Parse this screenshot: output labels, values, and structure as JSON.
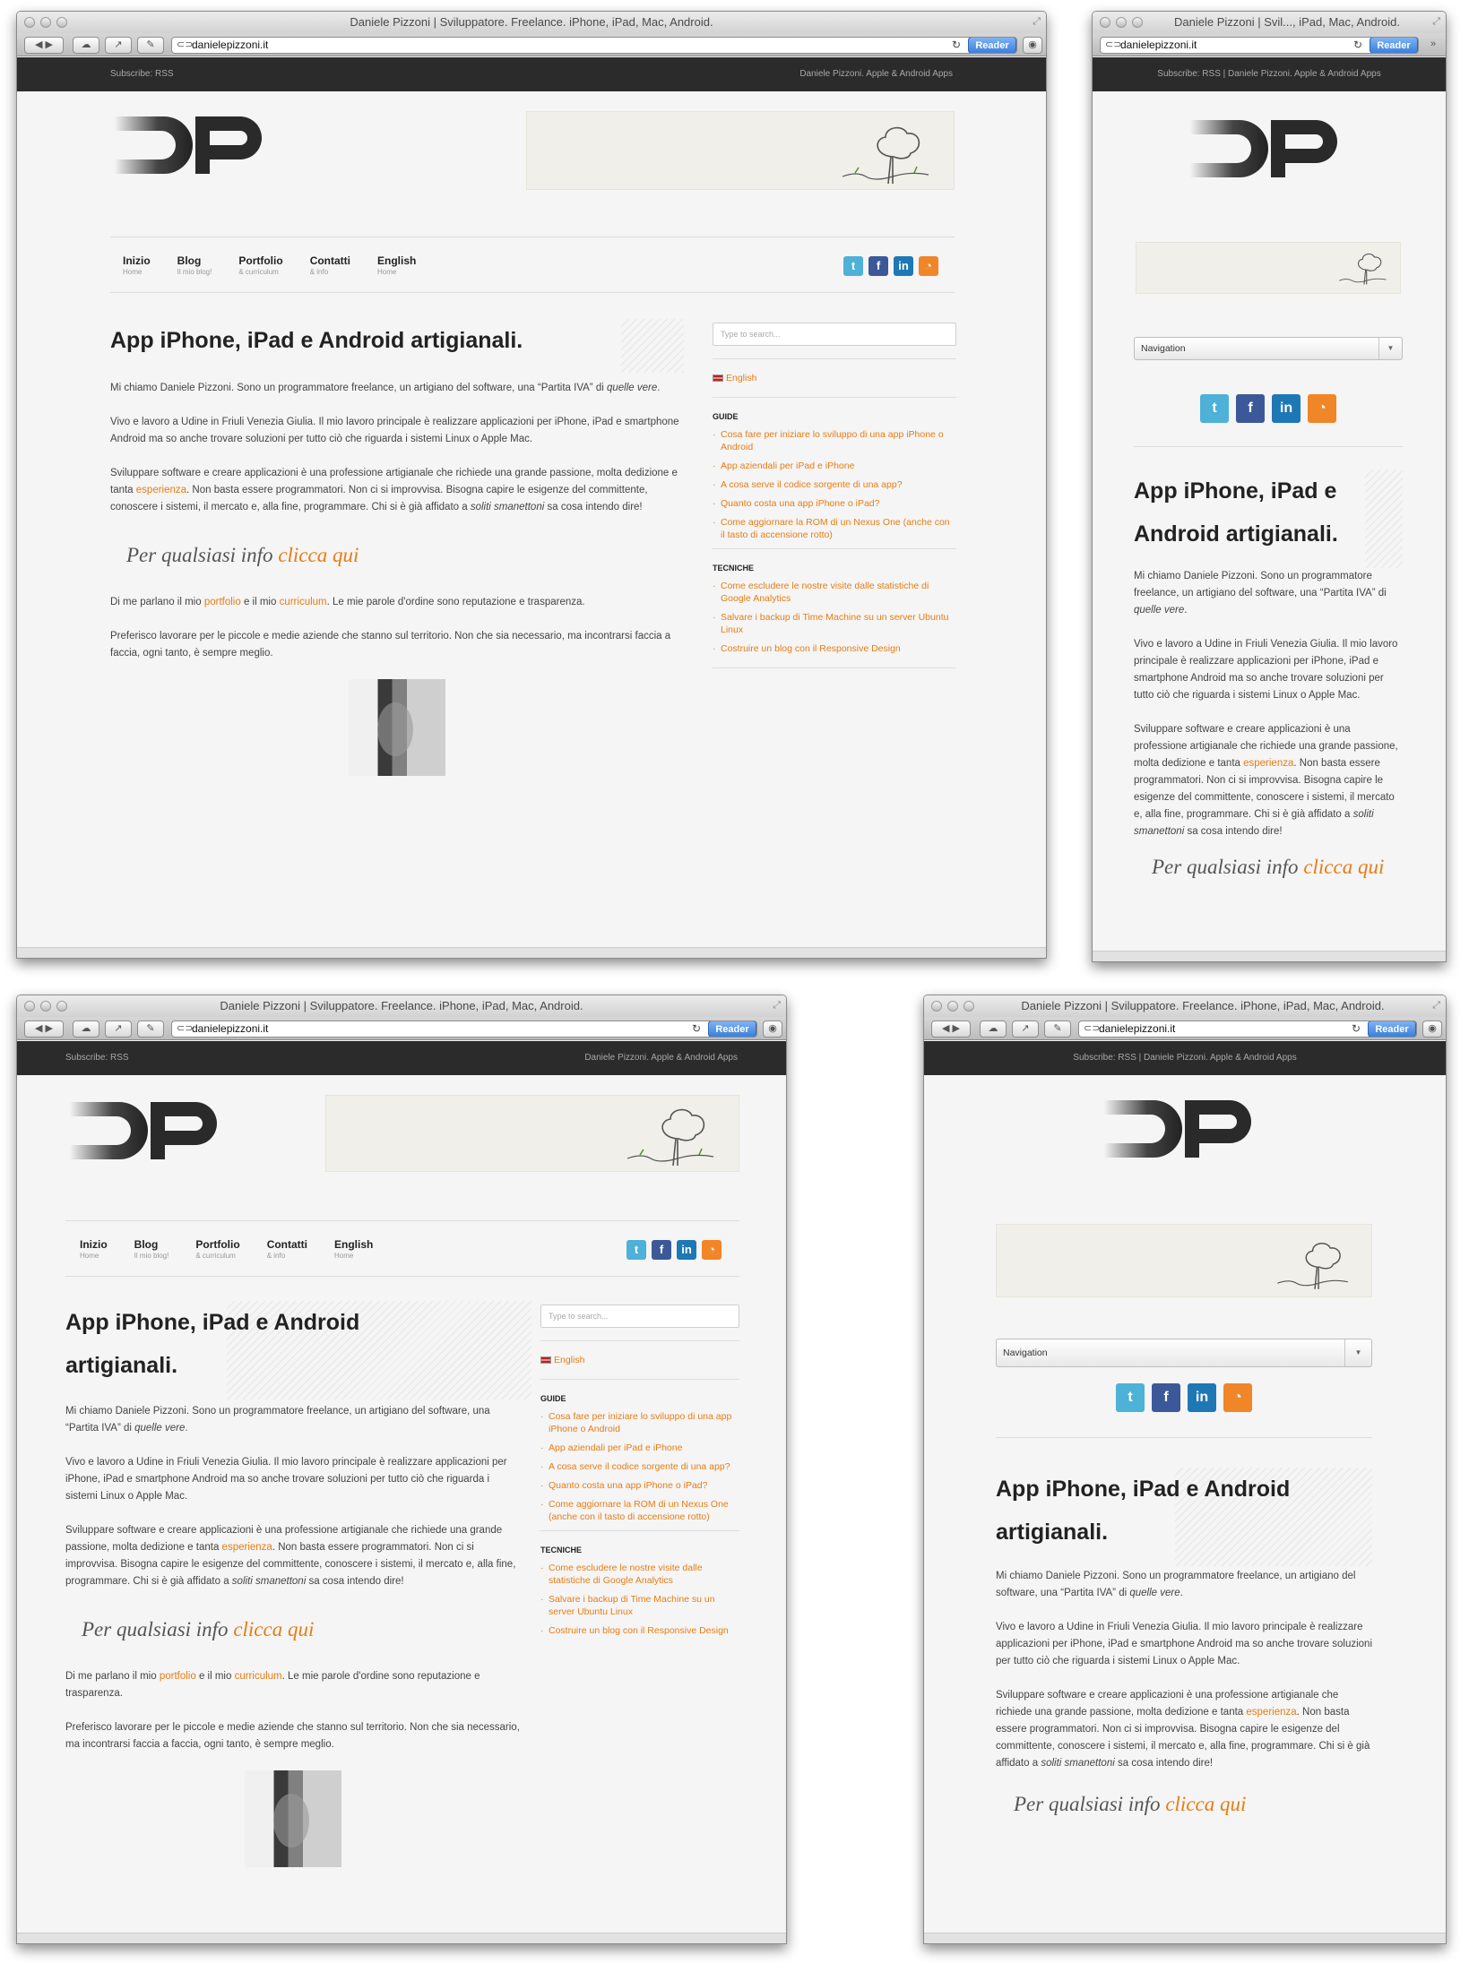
{
  "browser": {
    "title_full": "Daniele Pizzoni | Sviluppatore. Freelance. iPhone, iPad, Mac, Android.",
    "title_short": "Daniele Pizzoni | Svil..., iPad, Mac, Android.",
    "url": "danielepizzoni.it",
    "reader_label": "Reader"
  },
  "topbar": {
    "subscribe": "Subscribe: RSS",
    "tagline": "Daniele Pizzoni. Apple & Android Apps",
    "combined": "Subscribe: RSS | Daniele Pizzoni. Apple & Android Apps"
  },
  "nav": [
    {
      "label": "Inizio",
      "sub": "Home"
    },
    {
      "label": "Blog",
      "sub": "Il mio blog!"
    },
    {
      "label": "Portfolio",
      "sub": "& curriculum"
    },
    {
      "label": "Contatti",
      "sub": "& info"
    },
    {
      "label": "English",
      "sub": "Home"
    }
  ],
  "nav_select": "Navigation",
  "social": {
    "twitter": "t",
    "facebook": "f",
    "linkedin": "in",
    "rss": "rss-icon"
  },
  "main": {
    "title": "App iPhone, iPad e Android artigianali.",
    "p1_a": "Mi chiamo Daniele Pizzoni. Sono un programmatore freelance, un artigiano del software, una “Partita IVA” di ",
    "p1_em": "quelle vere",
    "p1_b": ".",
    "p2": "Vivo e lavoro a Udine in Friuli Venezia Giulia. Il mio lavoro principale è realizzare applicazioni per iPhone, iPad e smartphone Android ma so anche trovare soluzioni per tutto ciò che riguarda i sistemi Linux o Apple Mac.",
    "p3_a": "Sviluppare software e creare applicazioni è una professione artigianale che richiede una grande passione, molta dedizione e tanta ",
    "p3_link": "esperienza",
    "p3_b": ". Non basta essere programmatori. Non ci si improvvisa. Bisogna capire le esigenze del committente, conoscere i sistemi, il mercato e, alla fine, programmare.  Chi si è già affidato a ",
    "p3_em": "soliti smanettoni",
    "p3_c": " sa cosa intendo dire!",
    "cta_a": "Per qualsiasi info ",
    "cta_link": "clicca qui",
    "p4_a": "Di me parlano il mio ",
    "p4_l1": "portfolio",
    "p4_b": " e il mio ",
    "p4_l2": "curriculum",
    "p4_c": ". Le mie parole d'ordine sono reputazione e trasparenza.",
    "p5": "Preferisco lavorare per le piccole e medie aziende che stanno sul territorio. Non che sia necessario, ma incontrarsi faccia a faccia, ogni tanto, è sempre meglio."
  },
  "sidebar": {
    "search_placeholder": "Type to search...",
    "english": "English",
    "guide_heading": "GUIDE",
    "guide": [
      "Cosa fare per iniziare lo sviluppo di una app iPhone o Android",
      "App aziendali per iPad e iPhone",
      "A cosa serve il codice sorgente di una app?",
      "Quanto costa una app iPhone o iPad?",
      "Come aggiornare la ROM di un Nexus One (anche con il tasto di accensione rotto)"
    ],
    "tech_heading": "TECNICHE",
    "tech": [
      "Come escludere le nostre visite dalle statistiche di Google Analytics",
      "Salvare i backup di Time Machine su un server Ubuntu Linux",
      "Costruire un blog con il Responsive Design"
    ]
  },
  "colors": {
    "accent": "#e87c14",
    "topbar": "#2b2b2b",
    "reader": "#3b7fdc"
  }
}
